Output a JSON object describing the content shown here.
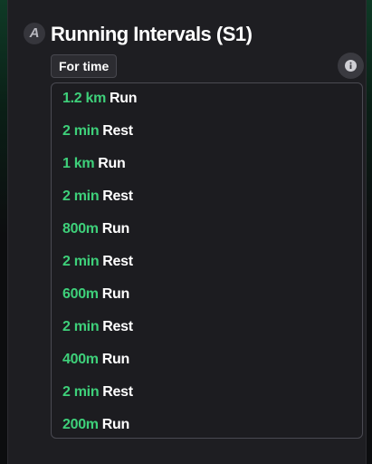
{
  "workout": {
    "part_badge": "A",
    "title": "Running Intervals (S1)",
    "scoring_type": "For time",
    "info_icon": "info-icon",
    "items": [
      {
        "amount": "1.2 km",
        "activity": "Run"
      },
      {
        "amount": "2 min",
        "activity": "Rest"
      },
      {
        "amount": "1 km",
        "activity": "Run"
      },
      {
        "amount": "2 min",
        "activity": "Rest"
      },
      {
        "amount": "800m",
        "activity": "Run"
      },
      {
        "amount": "2 min",
        "activity": "Rest"
      },
      {
        "amount": "600m",
        "activity": "Run"
      },
      {
        "amount": "2 min",
        "activity": "Rest"
      },
      {
        "amount": "400m",
        "activity": "Run"
      },
      {
        "amount": "2 min",
        "activity": "Rest"
      },
      {
        "amount": "200m",
        "activity": "Run"
      }
    ]
  },
  "colors": {
    "accent_green": "#3ed07a",
    "card_background": "#1e1e22",
    "text_primary": "#ffffff"
  }
}
